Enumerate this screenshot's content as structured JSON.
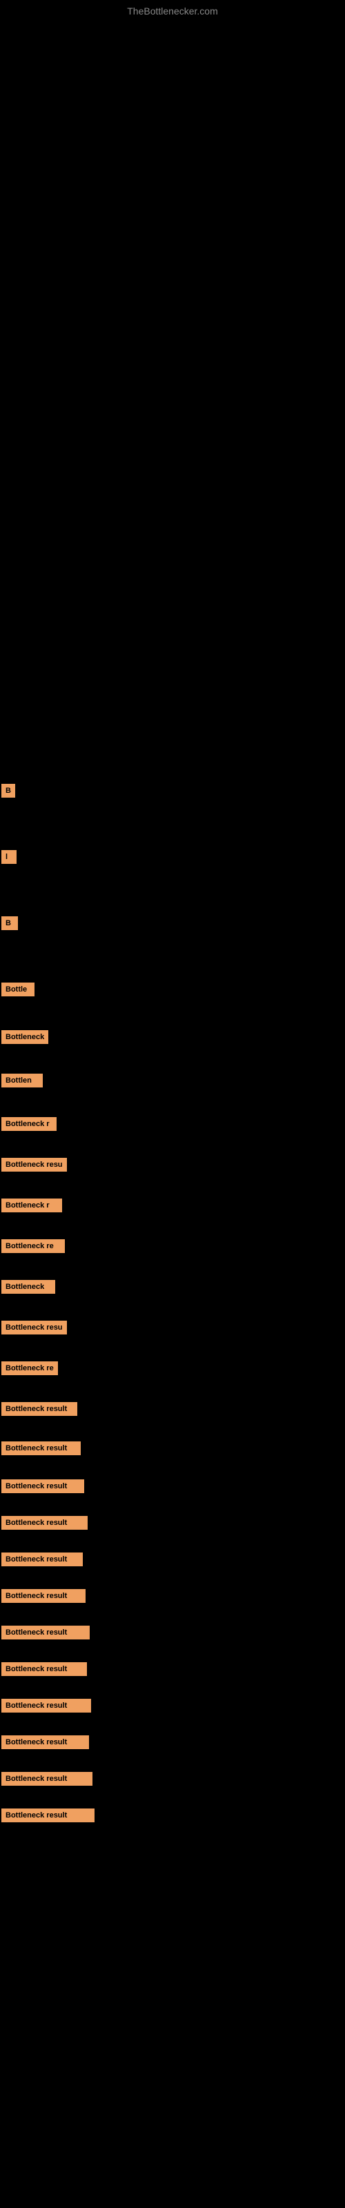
{
  "site": {
    "title": "TheBottlenecker.com"
  },
  "items": [
    {
      "id": 1,
      "label": "B",
      "widthClass": "bn-1"
    },
    {
      "id": 2,
      "label": "l",
      "widthClass": "bn-2"
    },
    {
      "id": 3,
      "label": "B",
      "widthClass": "bn-3"
    },
    {
      "id": 4,
      "label": "Bottle",
      "widthClass": "bn-4"
    },
    {
      "id": 5,
      "label": "Bottleneck",
      "widthClass": "bn-5"
    },
    {
      "id": 6,
      "label": "Bottlen",
      "widthClass": "bn-6"
    },
    {
      "id": 7,
      "label": "Bottleneck r",
      "widthClass": "bn-7"
    },
    {
      "id": 8,
      "label": "Bottleneck resu",
      "widthClass": "bn-8"
    },
    {
      "id": 9,
      "label": "Bottleneck r",
      "widthClass": "bn-9"
    },
    {
      "id": 10,
      "label": "Bottleneck re",
      "widthClass": "bn-10"
    },
    {
      "id": 11,
      "label": "Bottleneck",
      "widthClass": "bn-11"
    },
    {
      "id": 12,
      "label": "Bottleneck resu",
      "widthClass": "bn-12"
    },
    {
      "id": 13,
      "label": "Bottleneck re",
      "widthClass": "bn-13"
    },
    {
      "id": 14,
      "label": "Bottleneck result",
      "widthClass": "bn-14"
    },
    {
      "id": 15,
      "label": "Bottleneck result",
      "widthClass": "bn-15"
    },
    {
      "id": 16,
      "label": "Bottleneck result",
      "widthClass": "bn-16"
    },
    {
      "id": 17,
      "label": "Bottleneck result",
      "widthClass": "bn-17"
    },
    {
      "id": 18,
      "label": "Bottleneck result",
      "widthClass": "bn-18"
    },
    {
      "id": 19,
      "label": "Bottleneck result",
      "widthClass": "bn-19"
    },
    {
      "id": 20,
      "label": "Bottleneck result",
      "widthClass": "bn-20"
    },
    {
      "id": 21,
      "label": "Bottleneck result",
      "widthClass": "bn-21"
    },
    {
      "id": 22,
      "label": "Bottleneck result",
      "widthClass": "bn-22"
    },
    {
      "id": 23,
      "label": "Bottleneck result",
      "widthClass": "bn-23"
    },
    {
      "id": 24,
      "label": "Bottleneck result",
      "widthClass": "bn-24"
    },
    {
      "id": 25,
      "label": "Bottleneck result",
      "widthClass": "bn-25"
    }
  ]
}
